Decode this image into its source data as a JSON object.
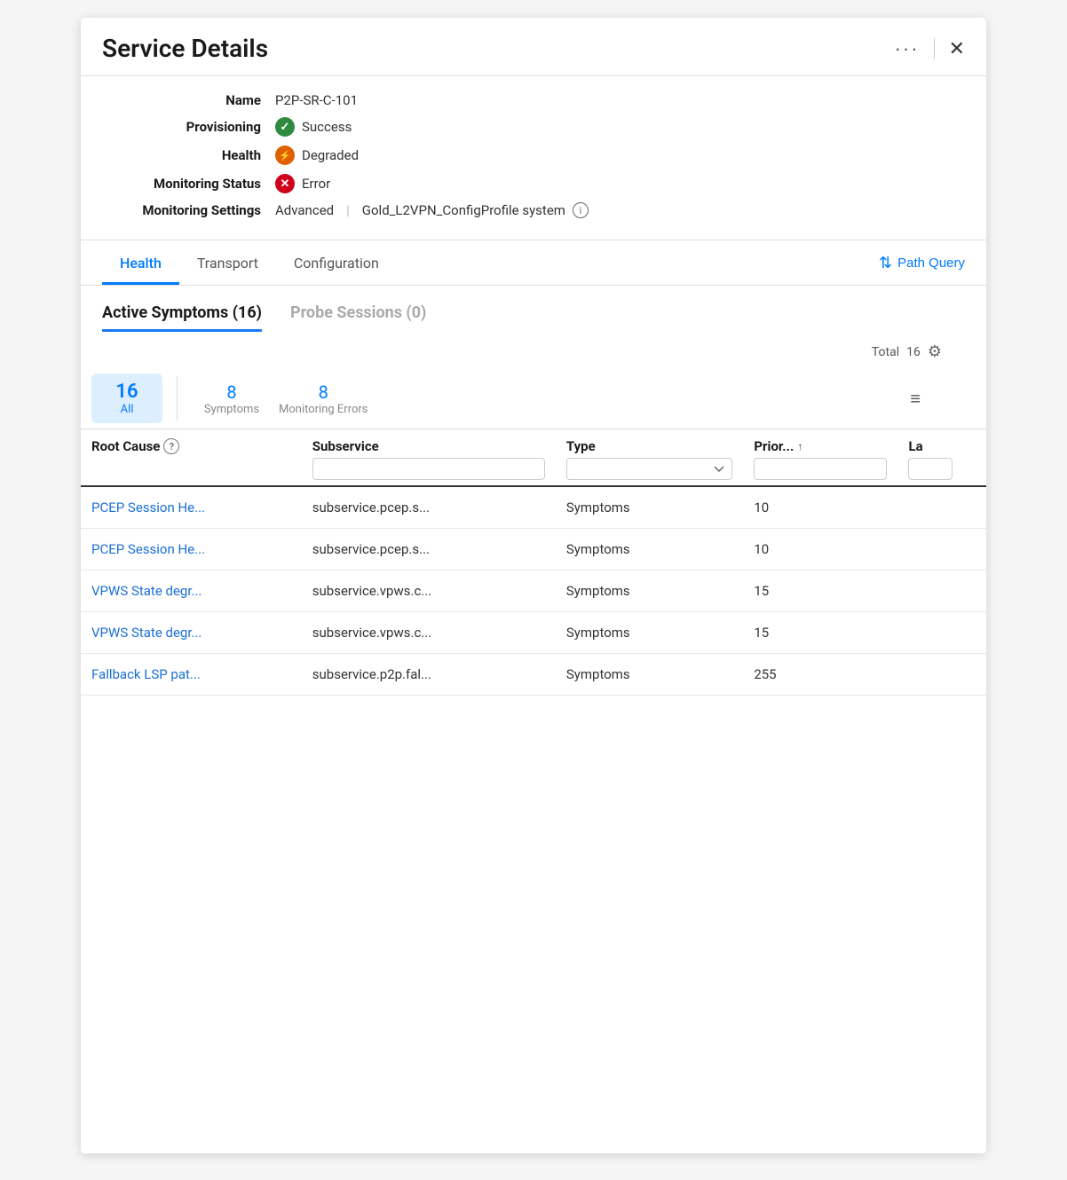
{
  "panel": {
    "title": "Service Details"
  },
  "info": {
    "name_label": "Name",
    "name_value": "P2P-SR-C-101",
    "provisioning_label": "Provisioning",
    "provisioning_status": "Success",
    "health_label": "Health",
    "health_status": "Degraded",
    "monitoring_status_label": "Monitoring Status",
    "monitoring_status_value": "Error",
    "monitoring_settings_label": "Monitoring Settings",
    "monitoring_settings_value": "Advanced",
    "monitoring_settings_profile": "Gold_L2VPN_ConfigProfile system"
  },
  "tabs": {
    "items": [
      {
        "id": "health",
        "label": "Health",
        "active": true
      },
      {
        "id": "transport",
        "label": "Transport",
        "active": false
      },
      {
        "id": "configuration",
        "label": "Configuration",
        "active": false
      }
    ],
    "path_query_label": "Path Query"
  },
  "sub_tabs": {
    "active_symptoms_label": "Active Symptoms (16)",
    "probe_sessions_label": "Probe Sessions (0)"
  },
  "summary": {
    "total_label": "Total",
    "total_count": "16"
  },
  "filter_chips": {
    "all_count": "16",
    "all_label": "All",
    "symptoms_count": "8",
    "symptoms_label": "Symptoms",
    "monitoring_errors_count": "8",
    "monitoring_errors_label": "Monitoring Errors"
  },
  "table": {
    "columns": [
      {
        "id": "root_cause",
        "label": "Root Cause"
      },
      {
        "id": "subservice",
        "label": "Subservice"
      },
      {
        "id": "type",
        "label": "Type"
      },
      {
        "id": "priority",
        "label": "Prior...",
        "sortable": true
      },
      {
        "id": "last",
        "label": "La"
      }
    ],
    "rows": [
      {
        "root_cause": "PCEP Session He...",
        "subservice": "subservice.pcep.s...",
        "type": "Symptoms",
        "priority": "10"
      },
      {
        "root_cause": "PCEP Session He...",
        "subservice": "subservice.pcep.s...",
        "type": "Symptoms",
        "priority": "10"
      },
      {
        "root_cause": "VPWS State degr...",
        "subservice": "subservice.vpws.c...",
        "type": "Symptoms",
        "priority": "15"
      },
      {
        "root_cause": "VPWS State degr...",
        "subservice": "subservice.vpws.c...",
        "type": "Symptoms",
        "priority": "15"
      },
      {
        "root_cause": "Fallback LSP pat...",
        "subservice": "subservice.p2p.fal...",
        "type": "Symptoms",
        "priority": "255"
      }
    ]
  },
  "colors": {
    "accent_blue": "#1a6fd4",
    "active_tab_blue": "#007bff",
    "success_green": "#2e8b3e",
    "degraded_orange": "#e06000",
    "error_red": "#d0021b"
  }
}
